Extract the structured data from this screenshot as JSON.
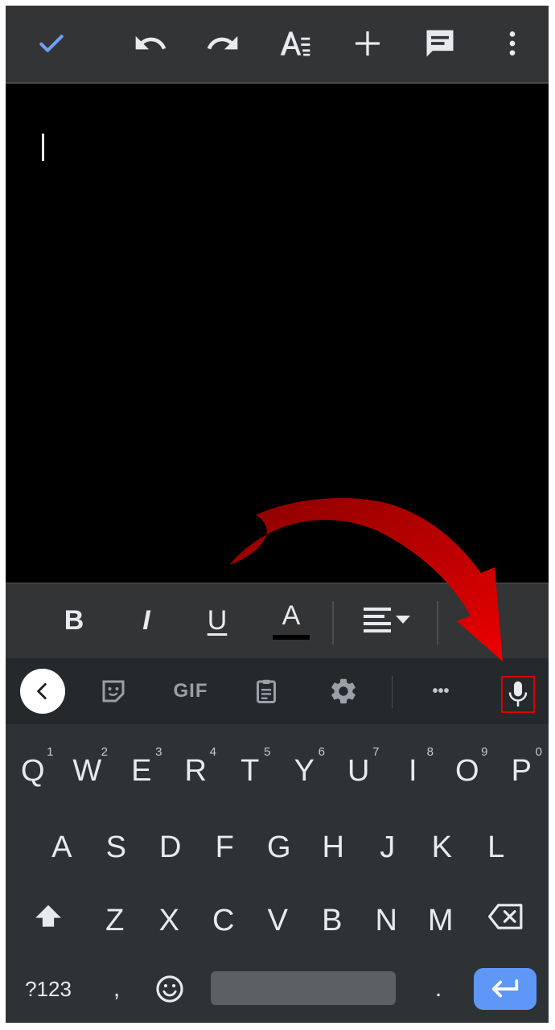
{
  "topbar": {
    "icons": [
      "check-icon",
      "undo-icon",
      "redo-icon",
      "text-format-icon",
      "insert-icon",
      "comment-icon",
      "more-vert-icon"
    ]
  },
  "format_bar": {
    "bold": "B",
    "italic": "I",
    "underline": "U",
    "text_color": "A"
  },
  "toolbar_strip": {
    "gif_label": "GIF",
    "more_label": "•••"
  },
  "keyboard": {
    "row1": [
      {
        "k": "Q",
        "h": "1"
      },
      {
        "k": "W",
        "h": "2"
      },
      {
        "k": "E",
        "h": "3"
      },
      {
        "k": "R",
        "h": "4"
      },
      {
        "k": "T",
        "h": "5"
      },
      {
        "k": "Y",
        "h": "6"
      },
      {
        "k": "U",
        "h": "7"
      },
      {
        "k": "I",
        "h": "8"
      },
      {
        "k": "O",
        "h": "9"
      },
      {
        "k": "P",
        "h": "0"
      }
    ],
    "row2": [
      "A",
      "S",
      "D",
      "F",
      "G",
      "H",
      "J",
      "K",
      "L"
    ],
    "row3": [
      "Z",
      "X",
      "C",
      "V",
      "B",
      "N",
      "M"
    ],
    "symbols_label": "?123",
    "comma": ",",
    "period": "."
  },
  "colors": {
    "accent_blue": "#5e97f6",
    "annotation_red": "#e00000"
  }
}
